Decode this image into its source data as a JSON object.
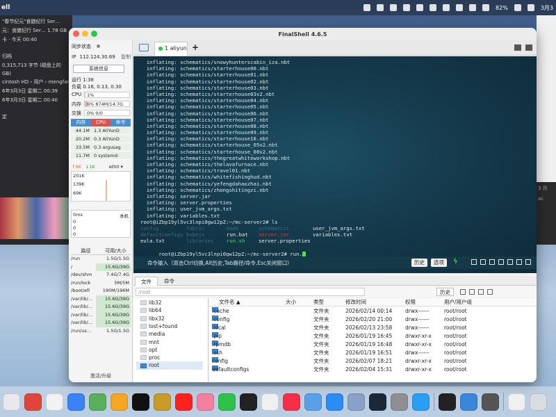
{
  "menubar": {
    "app_name": "ell",
    "battery_pct": "82%",
    "date": "3月3"
  },
  "bg_left": {
    "lines": [
      "\"春节纪元\"食膳纪行 Ser…",
      "元：食膳纪行 Ser…  1.78 GB",
      "卡 · 今天 00:40",
      "",
      "归档",
      "0,315,713 字节 (磁盘上的",
      "GB)",
      "cintosh HD › 用户 › mengfan ›",
      "6年3月3日 星期二 00:39",
      "6年3月3日 星期二 00:40",
      "",
      "定"
    ]
  },
  "bg_right": {
    "lines": [
      "3 月",
      "ac"
    ]
  },
  "window": {
    "title": "FinalShell 4.6.5"
  },
  "sidebar": {
    "sync_status": "同步状态",
    "ip_label": "IP",
    "ip_value": "112.124.30.69",
    "copy": "复制",
    "sysinfo_button": "系统信息",
    "uptime": "运行 1:38",
    "load": "负载 0.16, 0.13, 0.30",
    "cpu_label": "CPU",
    "cpu_value": "1%",
    "cpu_pct": 1,
    "mem_label": "内存",
    "mem_value": "6%   874M/14.7G",
    "mem_pct": 6,
    "swap_label": "交换",
    "swap_value": "0%             0/0",
    "swap_pct": 0,
    "proc_headers": [
      "内存",
      "CPU",
      "命令"
    ],
    "processes": [
      {
        "mem": "44.1M",
        "cpu_cmd": "1.3 AliYunD"
      },
      {
        "mem": "20.2M",
        "cpu_cmd": "0.3 AliYunD"
      },
      {
        "mem": "33.5M",
        "cpu_cmd": "0.3 argusag"
      },
      {
        "mem": "11.7M",
        "cpu_cmd": "0  systemd-"
      }
    ],
    "net_up": "↑9K",
    "net_down": "↓1K",
    "net_iface": "eth0 ▾",
    "net_scale": [
      "201K",
      "139K",
      "69K"
    ],
    "ping_label": "0ms",
    "ping_host": "本机",
    "ping_scale": [
      "0",
      "0",
      "0"
    ],
    "disk_headers": [
      "路径",
      "可用/大小"
    ],
    "disks": [
      {
        "path": "/run",
        "avail": "1.5G/1.5G",
        "hl": false
      },
      {
        "path": "/",
        "avail": "15.6G/39G",
        "hl": true
      },
      {
        "path": "/dev/shm",
        "avail": "7.4G/7.4G",
        "hl": false
      },
      {
        "path": "/run/lock",
        "avail": "5M/5M",
        "hl": false
      },
      {
        "path": "/boot/efi",
        "avail": "190M/196M",
        "hl": false
      },
      {
        "path": "/var/lib/…",
        "avail": "15.6G/39G",
        "hl": true
      },
      {
        "path": "/var/lib/…",
        "avail": "15.6G/39G",
        "hl": true
      },
      {
        "path": "/var/lib/…",
        "avail": "15.6G/39G",
        "hl": true
      },
      {
        "path": "/var/lib/…",
        "avail": "15.6G/39G",
        "hl": true
      },
      {
        "path": "/run/us…",
        "avail": "1.5G/1.5G",
        "hl": false
      }
    ],
    "upgrade": "激活/升级"
  },
  "tabs": {
    "active_tab": "1 aliyun",
    "add": "+"
  },
  "terminal": {
    "lines": [
      "  inflating: schematics/snowyhunterscabin_iza.nbt",
      "  inflating: schematics/starterhouse00.nbt",
      "  inflating: schematics/starterhouse01.nbt",
      "  inflating: schematics/starterhouse02.nbt",
      "  inflating: schematics/starterhouse03.nbt",
      "  inflating: schematics/starterhouse03v2.nbt",
      "  inflating: schematics/starterhouse04.nbt",
      "  inflating: schematics/starterhouse05.nbt",
      "  inflating: schematics/starterhouse06.nbt",
      "  inflating: schematics/starterhouse07.nbt",
      "  inflating: schematics/starterhouse08.nbt",
      "  inflating: schematics/starterhouse09.nbt",
      "  inflating: schematics/starterhouse10.nbt",
      "  inflating: schematics/starterhouse_05v2.nbt",
      "  inflating: schematics/starterhouse_08v2.nbt",
      "  inflating: schematics/thegreatwhiteworkshop.nbt",
      "  inflating: schematics/thelavafurnace.nbt",
      "  inflating: schematics/travel01.nbt",
      "  inflating: schematics/whitefishinghud.nbt",
      "  inflating: schematics/yefengdahaozhai.nbt",
      "  inflating: schematics/zhongshitingzi.nbt",
      "  inflating: server.jar",
      "  inflating: server.properties",
      "  inflating: user_jvm_args.txt",
      "  inflating: variables.txt",
      "root@iZbp19yl5vc3lnpi0gw12pZ:~/mc-server2# ls"
    ],
    "ls_rows": [
      [
        {
          "text": "config",
          "cls": "faded",
          "col": 0
        },
        {
          "text": "fabric",
          "cls": "faded",
          "col": 1
        },
        {
          "text": "mods",
          "cls": "faded",
          "col": 2
        },
        {
          "text": "schematics",
          "cls": "faded",
          "col": 3
        },
        {
          "text": "user_jvm_args.txt",
          "cls": "white",
          "col": 4
        }
      ],
      [
        {
          "text": "defaultconfigs",
          "cls": "faded",
          "col": 0
        },
        {
          "text": "kubejs",
          "cls": "faded",
          "col": 1
        },
        {
          "text": "run.bat",
          "cls": "white",
          "col": 2
        },
        {
          "text": "server.jar",
          "cls": "red",
          "col": 3
        },
        {
          "text": "variables.txt",
          "cls": "white",
          "col": 4
        }
      ],
      [
        {
          "text": "eula.txt",
          "cls": "white",
          "col": 0
        },
        {
          "text": "libraries",
          "cls": "faded",
          "col": 1
        },
        {
          "text": "run.sh",
          "cls": "green",
          "col": 2
        },
        {
          "text": "server.properties",
          "cls": "white",
          "col": 3
        },
        {
          "text": "",
          "cls": "red",
          "col": 4
        }
      ]
    ],
    "prompt_last": "root@iZbp19yl5vc3lnpi0gw12pZ:~/mc-server2# run.",
    "red_tail": "                    "
  },
  "cmdbar": {
    "label": "命令输入（双击Ctrl切换,Alt历史,Tab路径/命令,Esc关闭窗口）",
    "history": "历史",
    "options": "选项"
  },
  "files": {
    "tab_files": "文件",
    "tab_cmd": "命令",
    "path": "/root",
    "history": "历史",
    "tree": [
      {
        "name": "lib32",
        "sel": false
      },
      {
        "name": "lib64",
        "sel": false
      },
      {
        "name": "libx32",
        "sel": false
      },
      {
        "name": "lost+found",
        "sel": false
      },
      {
        "name": "media",
        "sel": false
      },
      {
        "name": "mnt",
        "sel": false
      },
      {
        "name": "opt",
        "sel": false
      },
      {
        "name": "proc",
        "sel": false
      },
      {
        "name": "root",
        "sel": true
      }
    ],
    "headers": [
      "文件名 ▲",
      "大小",
      "类型",
      "修改时间",
      "权限",
      "用户/用户组"
    ],
    "rows": [
      [
        ".cache",
        "",
        "文件夹",
        "2026/02/14 00:14",
        "drwx------",
        "root/root"
      ],
      [
        ".config",
        "",
        "文件夹",
        "2026/02/20 21:00",
        "drwx------",
        "root/root"
      ],
      [
        ".local",
        "",
        "文件夹",
        "2026/02/13 23:58",
        "drwx------",
        "root/root"
      ],
      [
        ".pip",
        "",
        "文件夹",
        "2026/01/19 16:45",
        "drwxr-xr-x",
        "root/root"
      ],
      [
        ".rpmdb",
        "",
        "文件夹",
        "2026/01/19 16:48",
        "drwxr-xr-x",
        "root/root"
      ],
      [
        ".ssh",
        "",
        "文件夹",
        "2026/01/19 16:51",
        "drwx------",
        "root/root"
      ],
      [
        "config",
        "",
        "文件夹",
        "2026/02/07 18:21",
        "drwxr-xr-x",
        "root/root"
      ],
      [
        "defaultconfigs",
        "",
        "文件夹",
        "2026/02/04 15:31",
        "drwxr-xr-x",
        "root/root"
      ]
    ]
  },
  "dock": {
    "icons": [
      {
        "name": "launchpad-icon",
        "color": "#e8e8ee"
      },
      {
        "name": "chrome-icon",
        "color": "#e0453a"
      },
      {
        "name": "rocket-icon",
        "color": "#f2f2f2"
      },
      {
        "name": "mail-icon",
        "color": "#3b82f6"
      },
      {
        "name": "maps-icon",
        "color": "#5ab05a"
      },
      {
        "name": "photos-icon",
        "color": "#f5a623"
      },
      {
        "name": "tiktok-icon",
        "color": "#111111"
      },
      {
        "name": "wow-icon",
        "color": "#c89a2a"
      },
      {
        "name": "youtube-icon",
        "color": "#ff2020"
      },
      {
        "name": "bilibili-icon",
        "color": "#f57fa0"
      },
      {
        "name": "wechat-icon",
        "color": "#2ec24a"
      },
      {
        "name": "intellij-icon",
        "color": "#222222"
      },
      {
        "name": "chatgpt-icon",
        "color": "#f0f0f0"
      },
      {
        "name": "music-icon",
        "color": "#fa2d48"
      },
      {
        "name": "finder-icon",
        "color": "#5aa0e8"
      },
      {
        "name": "appstore-icon",
        "color": "#2a8cf5"
      },
      {
        "name": "files-icon",
        "color": "#8aa0c8"
      },
      {
        "name": "steam-icon",
        "color": "#1b2838"
      },
      {
        "name": "settings-icon",
        "color": "#8e8e93"
      },
      {
        "name": "qq-icon",
        "color": "#2a9df4"
      },
      {
        "name": "terminal-icon",
        "color": "#222222"
      },
      {
        "name": "qqbrowser-icon",
        "color": "#3a86d8"
      },
      {
        "name": "window-icon",
        "color": "#555555"
      },
      {
        "name": "preview-icon",
        "color": "#f0f0f0"
      },
      {
        "name": "trash-icon",
        "color": "#d8dde4"
      }
    ]
  }
}
